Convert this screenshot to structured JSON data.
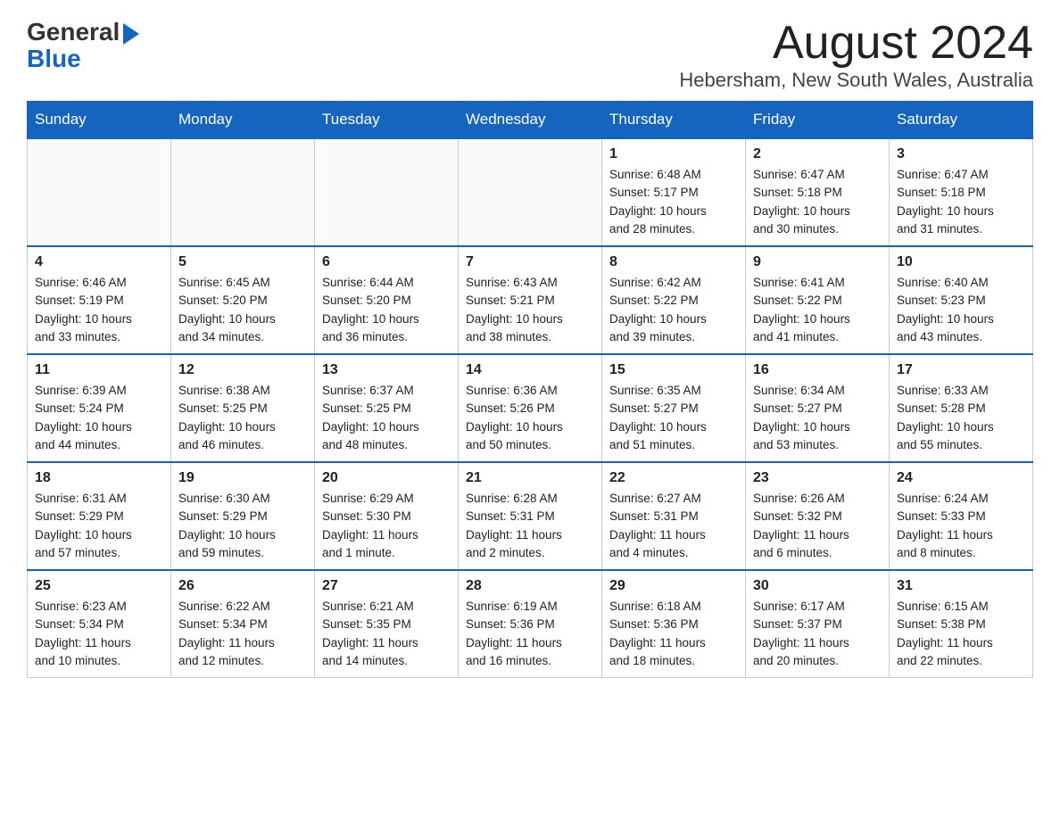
{
  "header": {
    "logo": {
      "general": "General",
      "arrow": "▶",
      "blue": "Blue"
    },
    "title": "August 2024",
    "subtitle": "Hebersham, New South Wales, Australia"
  },
  "weekdays": [
    "Sunday",
    "Monday",
    "Tuesday",
    "Wednesday",
    "Thursday",
    "Friday",
    "Saturday"
  ],
  "weeks": [
    [
      {
        "day": "",
        "info": ""
      },
      {
        "day": "",
        "info": ""
      },
      {
        "day": "",
        "info": ""
      },
      {
        "day": "",
        "info": ""
      },
      {
        "day": "1",
        "info": "Sunrise: 6:48 AM\nSunset: 5:17 PM\nDaylight: 10 hours\nand 28 minutes."
      },
      {
        "day": "2",
        "info": "Sunrise: 6:47 AM\nSunset: 5:18 PM\nDaylight: 10 hours\nand 30 minutes."
      },
      {
        "day": "3",
        "info": "Sunrise: 6:47 AM\nSunset: 5:18 PM\nDaylight: 10 hours\nand 31 minutes."
      }
    ],
    [
      {
        "day": "4",
        "info": "Sunrise: 6:46 AM\nSunset: 5:19 PM\nDaylight: 10 hours\nand 33 minutes."
      },
      {
        "day": "5",
        "info": "Sunrise: 6:45 AM\nSunset: 5:20 PM\nDaylight: 10 hours\nand 34 minutes."
      },
      {
        "day": "6",
        "info": "Sunrise: 6:44 AM\nSunset: 5:20 PM\nDaylight: 10 hours\nand 36 minutes."
      },
      {
        "day": "7",
        "info": "Sunrise: 6:43 AM\nSunset: 5:21 PM\nDaylight: 10 hours\nand 38 minutes."
      },
      {
        "day": "8",
        "info": "Sunrise: 6:42 AM\nSunset: 5:22 PM\nDaylight: 10 hours\nand 39 minutes."
      },
      {
        "day": "9",
        "info": "Sunrise: 6:41 AM\nSunset: 5:22 PM\nDaylight: 10 hours\nand 41 minutes."
      },
      {
        "day": "10",
        "info": "Sunrise: 6:40 AM\nSunset: 5:23 PM\nDaylight: 10 hours\nand 43 minutes."
      }
    ],
    [
      {
        "day": "11",
        "info": "Sunrise: 6:39 AM\nSunset: 5:24 PM\nDaylight: 10 hours\nand 44 minutes."
      },
      {
        "day": "12",
        "info": "Sunrise: 6:38 AM\nSunset: 5:25 PM\nDaylight: 10 hours\nand 46 minutes."
      },
      {
        "day": "13",
        "info": "Sunrise: 6:37 AM\nSunset: 5:25 PM\nDaylight: 10 hours\nand 48 minutes."
      },
      {
        "day": "14",
        "info": "Sunrise: 6:36 AM\nSunset: 5:26 PM\nDaylight: 10 hours\nand 50 minutes."
      },
      {
        "day": "15",
        "info": "Sunrise: 6:35 AM\nSunset: 5:27 PM\nDaylight: 10 hours\nand 51 minutes."
      },
      {
        "day": "16",
        "info": "Sunrise: 6:34 AM\nSunset: 5:27 PM\nDaylight: 10 hours\nand 53 minutes."
      },
      {
        "day": "17",
        "info": "Sunrise: 6:33 AM\nSunset: 5:28 PM\nDaylight: 10 hours\nand 55 minutes."
      }
    ],
    [
      {
        "day": "18",
        "info": "Sunrise: 6:31 AM\nSunset: 5:29 PM\nDaylight: 10 hours\nand 57 minutes."
      },
      {
        "day": "19",
        "info": "Sunrise: 6:30 AM\nSunset: 5:29 PM\nDaylight: 10 hours\nand 59 minutes."
      },
      {
        "day": "20",
        "info": "Sunrise: 6:29 AM\nSunset: 5:30 PM\nDaylight: 11 hours\nand 1 minute."
      },
      {
        "day": "21",
        "info": "Sunrise: 6:28 AM\nSunset: 5:31 PM\nDaylight: 11 hours\nand 2 minutes."
      },
      {
        "day": "22",
        "info": "Sunrise: 6:27 AM\nSunset: 5:31 PM\nDaylight: 11 hours\nand 4 minutes."
      },
      {
        "day": "23",
        "info": "Sunrise: 6:26 AM\nSunset: 5:32 PM\nDaylight: 11 hours\nand 6 minutes."
      },
      {
        "day": "24",
        "info": "Sunrise: 6:24 AM\nSunset: 5:33 PM\nDaylight: 11 hours\nand 8 minutes."
      }
    ],
    [
      {
        "day": "25",
        "info": "Sunrise: 6:23 AM\nSunset: 5:34 PM\nDaylight: 11 hours\nand 10 minutes."
      },
      {
        "day": "26",
        "info": "Sunrise: 6:22 AM\nSunset: 5:34 PM\nDaylight: 11 hours\nand 12 minutes."
      },
      {
        "day": "27",
        "info": "Sunrise: 6:21 AM\nSunset: 5:35 PM\nDaylight: 11 hours\nand 14 minutes."
      },
      {
        "day": "28",
        "info": "Sunrise: 6:19 AM\nSunset: 5:36 PM\nDaylight: 11 hours\nand 16 minutes."
      },
      {
        "day": "29",
        "info": "Sunrise: 6:18 AM\nSunset: 5:36 PM\nDaylight: 11 hours\nand 18 minutes."
      },
      {
        "day": "30",
        "info": "Sunrise: 6:17 AM\nSunset: 5:37 PM\nDaylight: 11 hours\nand 20 minutes."
      },
      {
        "day": "31",
        "info": "Sunrise: 6:15 AM\nSunset: 5:38 PM\nDaylight: 11 hours\nand 22 minutes."
      }
    ]
  ]
}
